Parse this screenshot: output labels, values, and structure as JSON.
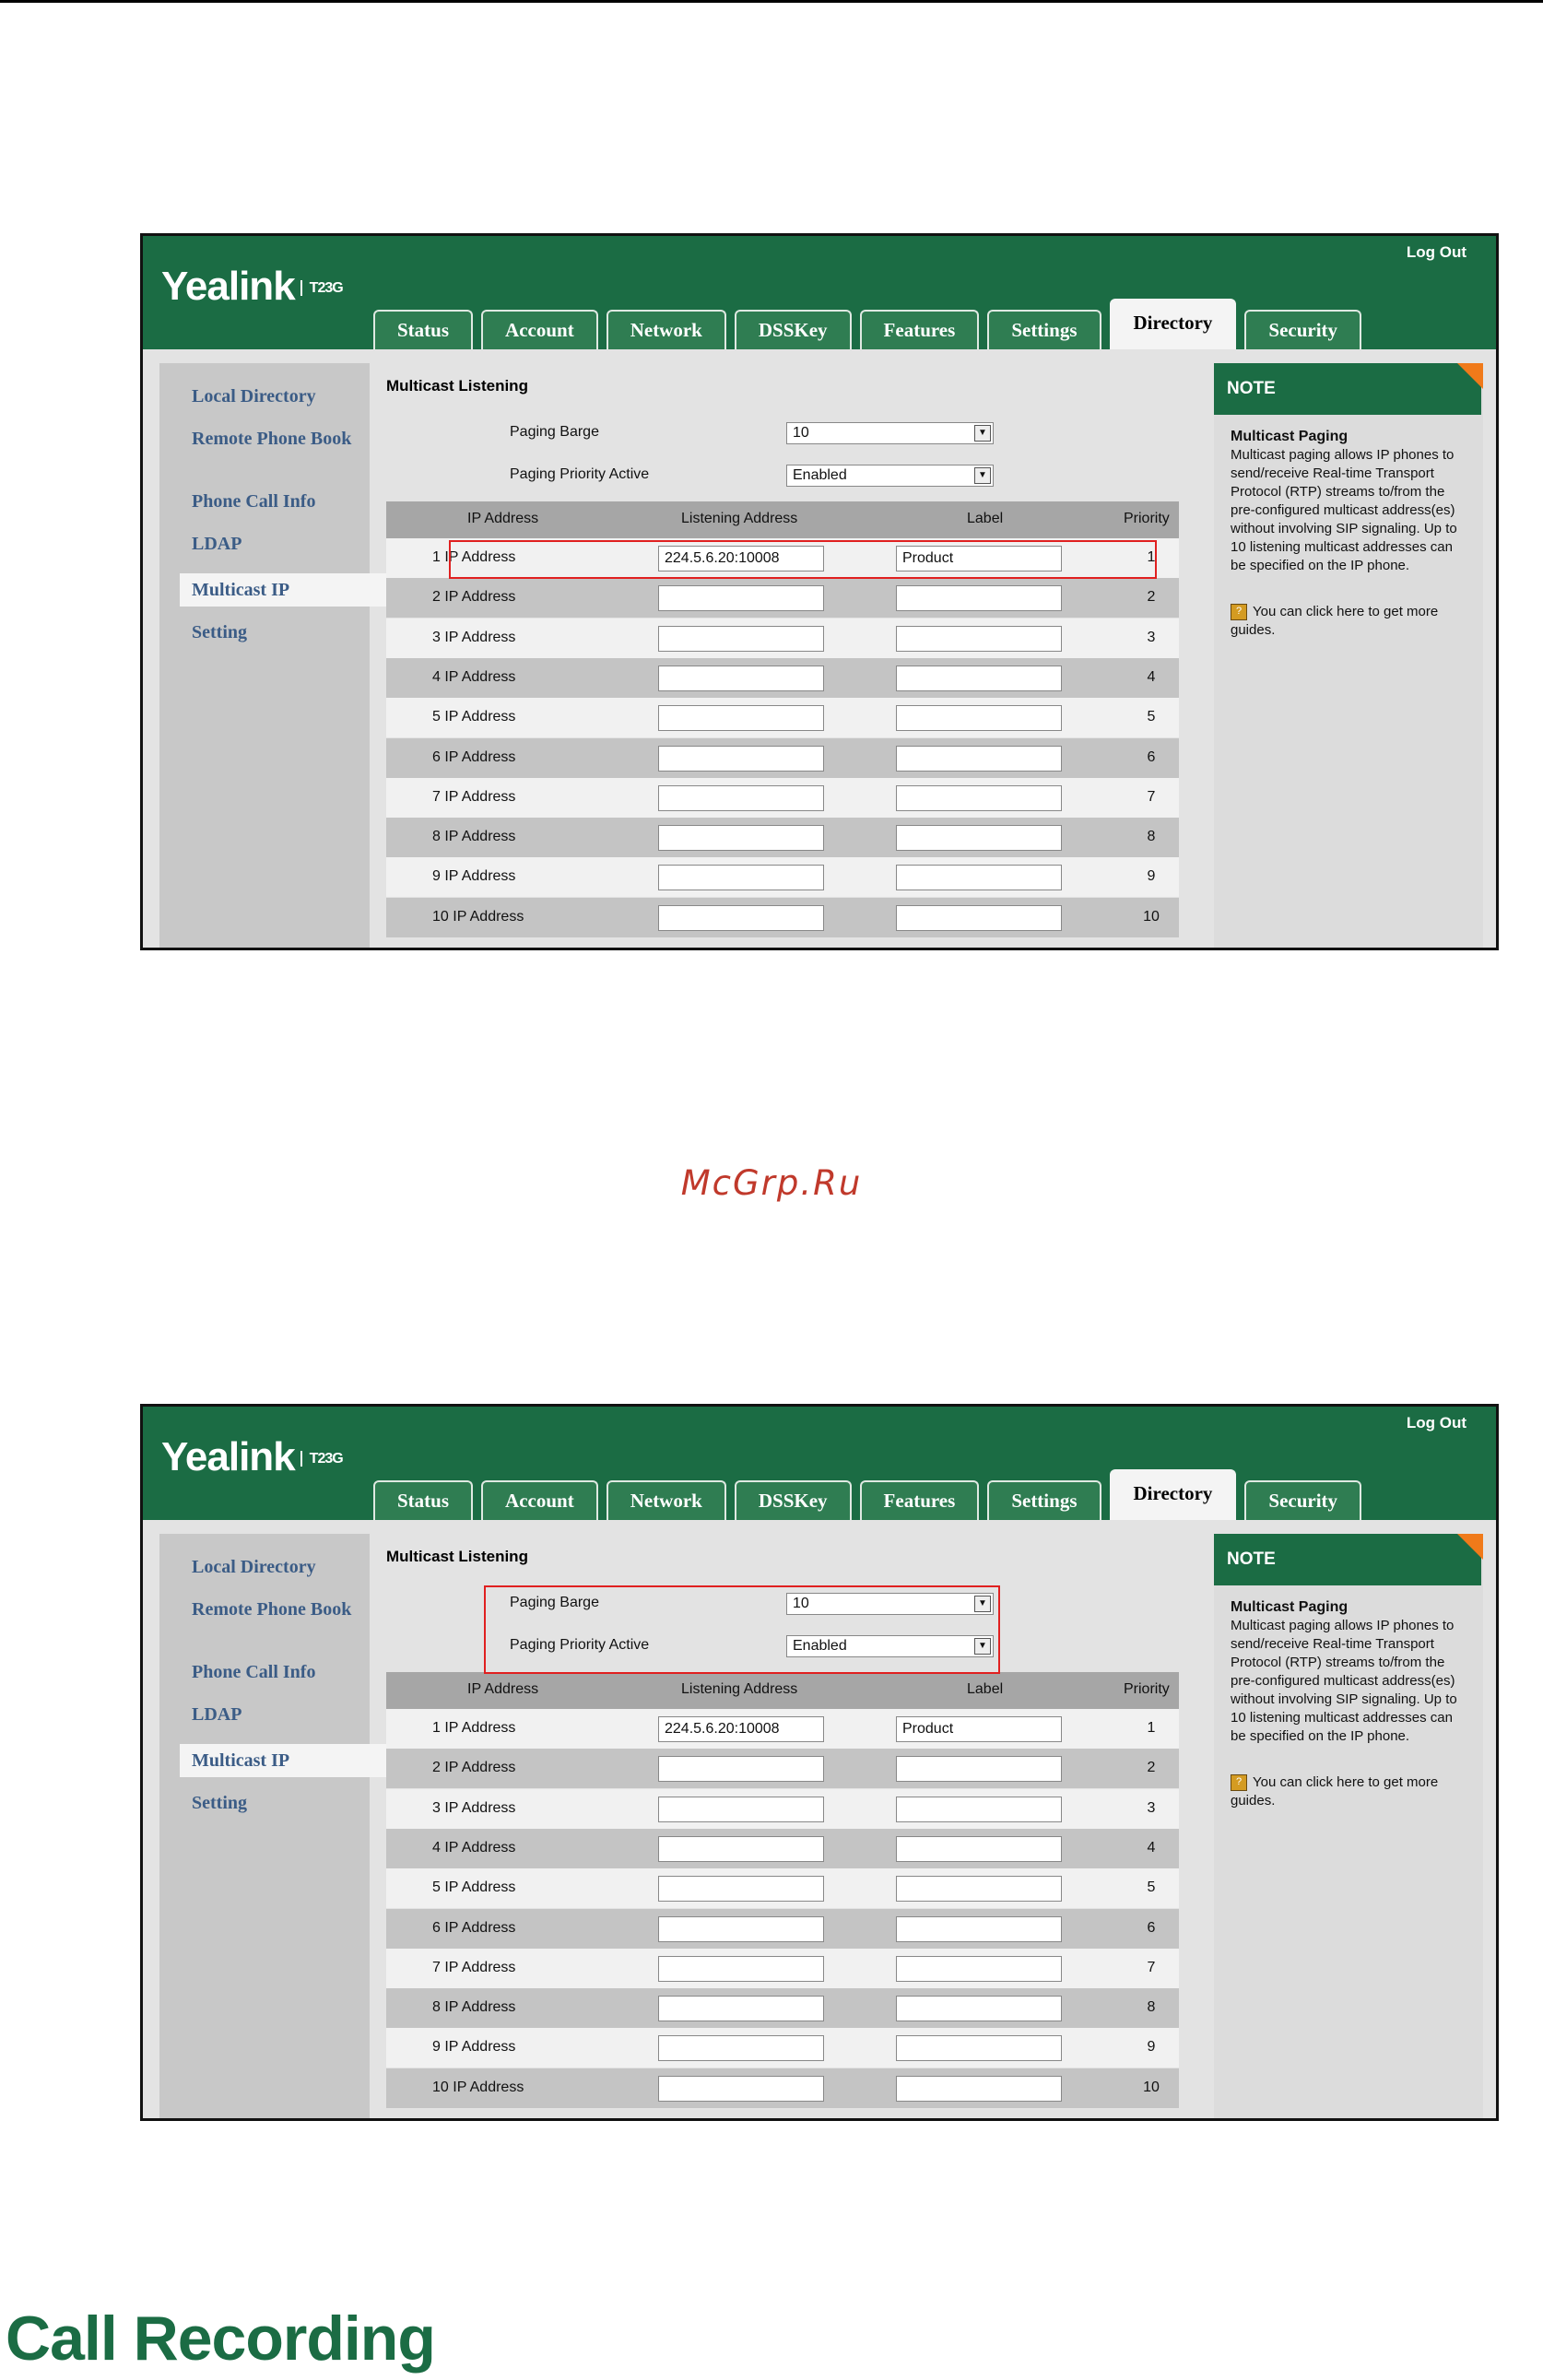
{
  "watermark": "McGrp.Ru",
  "section_heading": "Call Recording",
  "app": {
    "logo": "Yealink",
    "model": "T23G",
    "logout": "Log Out",
    "tabs": [
      "Status",
      "Account",
      "Network",
      "DSSKey",
      "Features",
      "Settings",
      "Directory",
      "Security"
    ],
    "active_tab": "Directory",
    "sidebar": [
      "Local Directory",
      "Remote Phone Book",
      "Phone Call Info",
      "LDAP",
      "Multicast IP",
      "Setting"
    ],
    "active_sidebar": "Multicast IP",
    "section_title": "Multicast Listening",
    "paging_barge_label": "Paging Barge",
    "paging_barge_value": "10",
    "paging_priority_label": "Paging Priority Active",
    "paging_priority_value": "Enabled",
    "table_headers": [
      "IP Address",
      "Listening Address",
      "Label",
      "Priority"
    ],
    "rows": [
      {
        "name": "1  IP Address",
        "listening": "224.5.6.20:10008",
        "label": "Product",
        "priority": "1"
      },
      {
        "name": "2  IP Address",
        "listening": "",
        "label": "",
        "priority": "2"
      },
      {
        "name": "3  IP Address",
        "listening": "",
        "label": "",
        "priority": "3"
      },
      {
        "name": "4  IP Address",
        "listening": "",
        "label": "",
        "priority": "4"
      },
      {
        "name": "5  IP Address",
        "listening": "",
        "label": "",
        "priority": "5"
      },
      {
        "name": "6  IP Address",
        "listening": "",
        "label": "",
        "priority": "6"
      },
      {
        "name": "7  IP Address",
        "listening": "",
        "label": "",
        "priority": "7"
      },
      {
        "name": "8  IP Address",
        "listening": "",
        "label": "",
        "priority": "8"
      },
      {
        "name": "9  IP Address",
        "listening": "",
        "label": "",
        "priority": "9"
      },
      {
        "name": "10  IP Address",
        "listening": "",
        "label": "",
        "priority": "10"
      }
    ],
    "note_title": "NOTE",
    "note_heading": "Multicast Paging",
    "note_text": "Multicast paging allows IP phones to send/receive Real-time Transport Protocol (RTP) streams to/from the pre-configured multicast address(es) without involving SIP signaling. Up to 10 listening multicast addresses can be specified on the IP phone.",
    "note_guide": "You can click here to get more guides.",
    "colors": {
      "header": "#1b6c44",
      "highlight": "#e02020",
      "note_corner": "#f07a1a"
    }
  }
}
